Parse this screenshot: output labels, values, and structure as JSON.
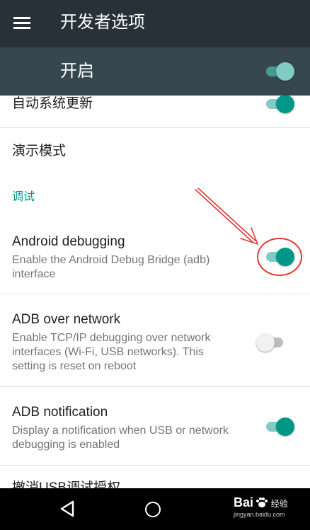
{
  "app_bar": {
    "title": "开发者选项",
    "menu_icon": "hamburger-menu-icon"
  },
  "master_switch": {
    "label": "开启",
    "on": true
  },
  "settings": {
    "auto_update": {
      "title": "自动系统更新",
      "on": true
    },
    "demo_mode": {
      "title": "演示模式"
    },
    "debug_category": "调试",
    "android_debugging": {
      "title": "Android debugging",
      "summary": "Enable the Android Debug Bridge (adb) interface",
      "on": true
    },
    "adb_over_network": {
      "title": "ADB over network",
      "summary": "Enable TCP/IP debugging over network interfaces (Wi-Fi, USB networks). This setting is reset on reboot",
      "on": false
    },
    "adb_notification": {
      "title": "ADB notification",
      "summary": "Display a notification when USB or network debugging is enabled",
      "on": true
    },
    "revoke_usb": {
      "title": "撤消USB调试授权"
    }
  },
  "nav_bar": {
    "back_icon": "back-triangle-icon",
    "home_icon": "home-circle-icon"
  },
  "watermark": {
    "brand": "Bai",
    "brand_suffix": "经验",
    "site": "jingyan.baidu.com"
  },
  "colors": {
    "app_bar": "#263238",
    "master_bar": "#37474f",
    "accent": "#009688",
    "annotation": "#e53935"
  }
}
